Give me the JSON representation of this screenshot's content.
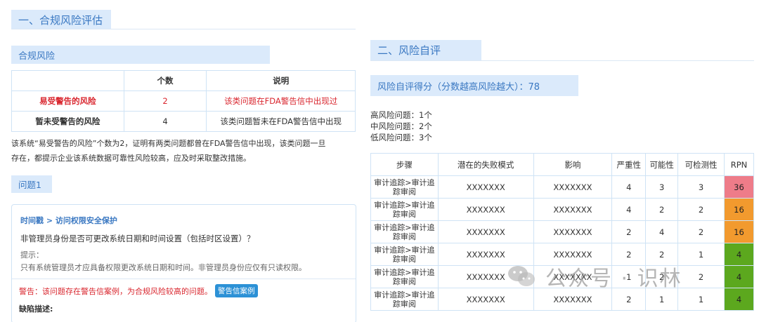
{
  "section1": {
    "title": "一、合规风险评估"
  },
  "compliance": {
    "heading": "合规风险",
    "columns": [
      "",
      "个数",
      "说明"
    ],
    "rows": [
      {
        "label": "易受警告的风险",
        "count": "2",
        "desc": "该类问题在FDA警告信中出现过"
      },
      {
        "label": "暂未受警告的风险",
        "count": "4",
        "desc": "该类问题暂未在FDA警告信中出现"
      }
    ]
  },
  "summary": {
    "line1": "该系统“易受警告的风险”个数为2，证明有两类问题都曾在FDA警告信中出现，该类问题一旦",
    "line2": "存在，都提示企业该系统数据可靠性风险较高，应及时采取整改措施。"
  },
  "issue": {
    "heading": "问题1",
    "title": "时间戳 > 访问权限安全保护",
    "question": "非管理员身份是否可更改系统日期和时间设置（包括时区设置）？",
    "hint_label": "提示：",
    "hint": "只有系统管理员才应具备权限更改系统日期和时间。非管理员身份应仅有只读权限。",
    "warning": "警告：该问题存在警告信案例，为合规风险较高的问题。",
    "warning_button": "警告信案例",
    "defect_label": "缺陷描述:"
  },
  "section2": {
    "title": "二、风险自评"
  },
  "score": {
    "label": "风险自评得分（分数越高风险越大）：78"
  },
  "counts": {
    "high": "高风险问题：1个",
    "medium": "中风险问题：2个",
    "low": "低风险问题：3个"
  },
  "risk_table": {
    "headers": [
      "步骤",
      "潜在的失败模式",
      "影响",
      "严重性",
      "可能性",
      "可检测性",
      "RPN"
    ],
    "rows": [
      {
        "step": "审计追踪>审计追踪审阅",
        "mode": "XXXXXXX",
        "impact": "XXXXXXX",
        "severity": "4",
        "likelihood": "3",
        "detectability": "3",
        "rpn": "36",
        "level": "red"
      },
      {
        "step": "审计追踪>审计追踪审阅",
        "mode": "XXXXXXX",
        "impact": "XXXXXXX",
        "severity": "4",
        "likelihood": "2",
        "detectability": "2",
        "rpn": "16",
        "level": "orange"
      },
      {
        "step": "审计追踪>审计追踪审阅",
        "mode": "XXXXXXX",
        "impact": "XXXXXXX",
        "severity": "2",
        "likelihood": "4",
        "detectability": "2",
        "rpn": "16",
        "level": "orange"
      },
      {
        "step": "审计追踪>审计追踪审阅",
        "mode": "XXXXXXX",
        "impact": "XXXXXXX",
        "severity": "2",
        "likelihood": "2",
        "detectability": "1",
        "rpn": "4",
        "level": "green"
      },
      {
        "step": "审计追踪>审计追踪审阅",
        "mode": "XXXXXXX",
        "impact": "XXXXXXX",
        "severity": "1",
        "likelihood": "2",
        "detectability": "2",
        "rpn": "4",
        "level": "green"
      },
      {
        "step": "审计追踪>审计追踪审阅",
        "mode": "XXXXXXX",
        "impact": "XXXXXXX",
        "severity": "2",
        "likelihood": "1",
        "detectability": "1",
        "rpn": "4",
        "level": "green"
      }
    ]
  },
  "colors": {
    "red": "#ee7c89",
    "orange": "#f29a2e",
    "green": "#5ca81e",
    "accent": "#3a78c2",
    "heading_bg": "#dbeafb"
  },
  "watermark": {
    "text": "公众号 · 识林",
    "icon": "wechat-icon"
  }
}
